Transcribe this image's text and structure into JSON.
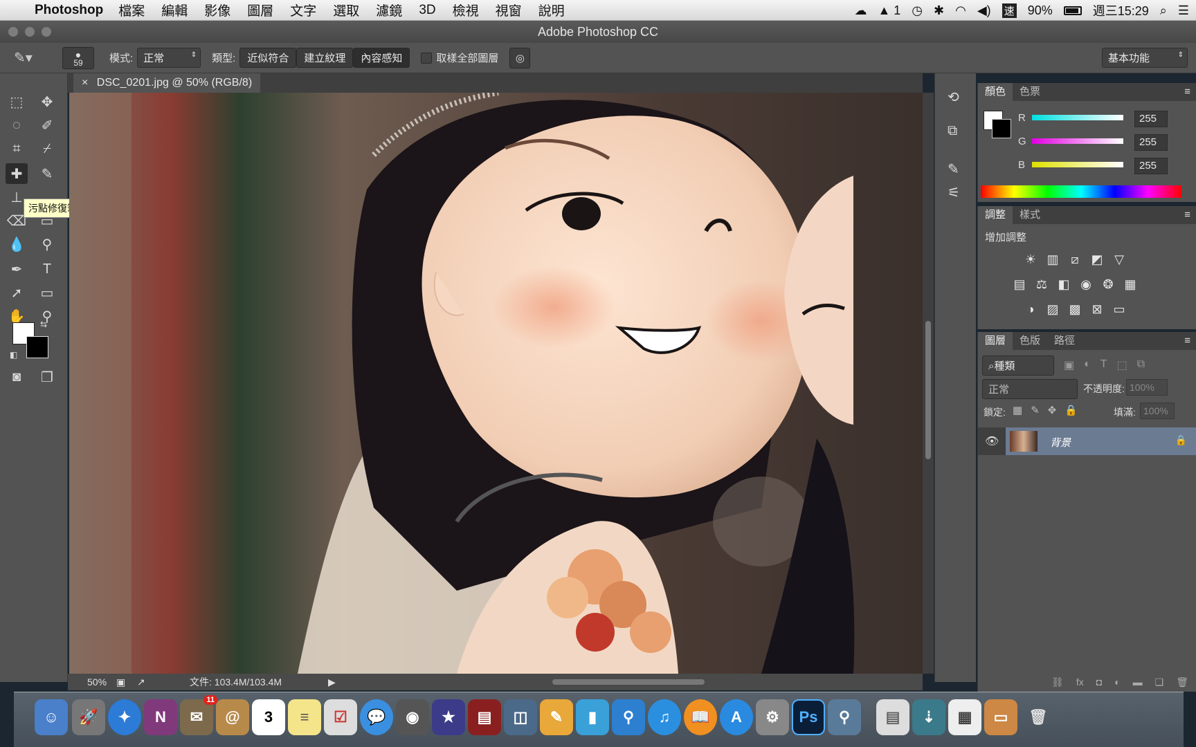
{
  "menubar": {
    "app_name": "Photoshop",
    "items": [
      "檔案",
      "編輯",
      "影像",
      "圖層",
      "文字",
      "選取",
      "濾鏡",
      "3D",
      "檢視",
      "視窗",
      "說明"
    ],
    "adobe_badge": "1",
    "battery": "90%",
    "clock": "週三15:29"
  },
  "window": {
    "title": "Adobe Photoshop CC"
  },
  "options": {
    "brush_size": "59",
    "mode_label": "模式:",
    "mode_value": "正常",
    "type_label": "類型:",
    "type_buttons": [
      "近似符合",
      "建立紋理",
      "內容感知"
    ],
    "sample_all_label": "取樣全部圖層",
    "workspace": "基本功能"
  },
  "tooltip": "污點修復筆刷工具 (J)",
  "document": {
    "tab_title": "DSC_0201.jpg @ 50% (RGB/8)"
  },
  "status": {
    "zoom": "50%",
    "doc_info": "文件: 103.4M/103.4M"
  },
  "color_panel": {
    "tabs": [
      "顏色",
      "色票"
    ],
    "channels": [
      {
        "label": "R",
        "value": "255",
        "color": "#00e0e0"
      },
      {
        "label": "G",
        "value": "255",
        "color": "#e000e0"
      },
      {
        "label": "B",
        "value": "255",
        "color": "#e0e000"
      }
    ]
  },
  "adjustments_panel": {
    "tabs": [
      "調整",
      "樣式"
    ],
    "heading": "增加調整"
  },
  "layers_panel": {
    "tabs": [
      "圖層",
      "色版",
      "路徑"
    ],
    "filter_label": "種類",
    "blend_mode": "正常",
    "opacity_label": "不透明度:",
    "opacity_value": "100%",
    "lock_label": "鎖定:",
    "fill_label": "填滿:",
    "fill_value": "100%",
    "layer_name": "背景"
  },
  "dock_badges": {
    "mail": "11",
    "calendar": "3"
  }
}
